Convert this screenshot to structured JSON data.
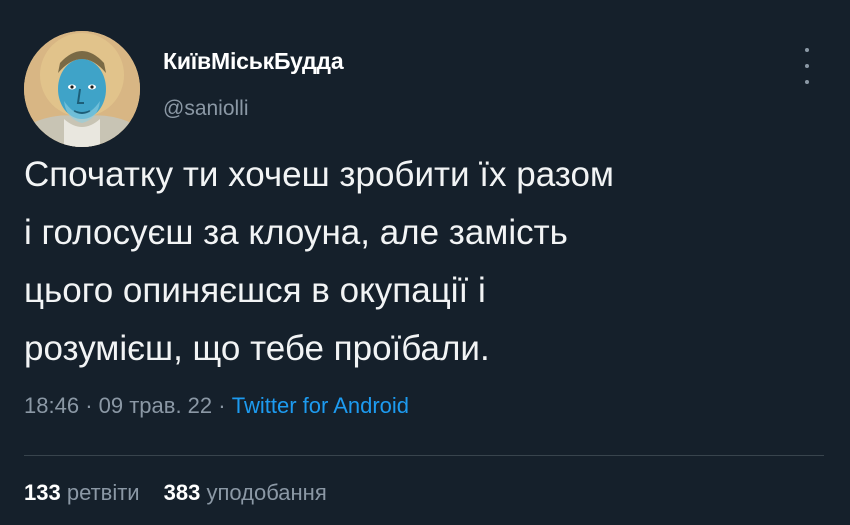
{
  "user": {
    "display_name": "КиївМіськБудда",
    "handle": "@saniolli",
    "avatar_icon": "icon-portrait-avatar"
  },
  "more_icon": "vertical-ellipsis-icon",
  "tweet": {
    "lines": [
      "Спочатку ти хочеш зробити їх разом",
      "і голосуєш за клоуна, але замість",
      "цього опиняєшся в окупації і",
      "розумієш, що тебе проїбали."
    ]
  },
  "meta": {
    "time": "18:46",
    "separator": "·",
    "date": "09 трав. 22",
    "source": "Twitter for Android"
  },
  "stats": {
    "retweets_count": "133",
    "retweets_label": "ретвіти",
    "likes_count": "383",
    "likes_label": "уподобання"
  },
  "colors": {
    "background": "#15202b",
    "text": "#f2f4f5",
    "secondary": "#8b98a5",
    "accent": "#1d9bf0"
  }
}
